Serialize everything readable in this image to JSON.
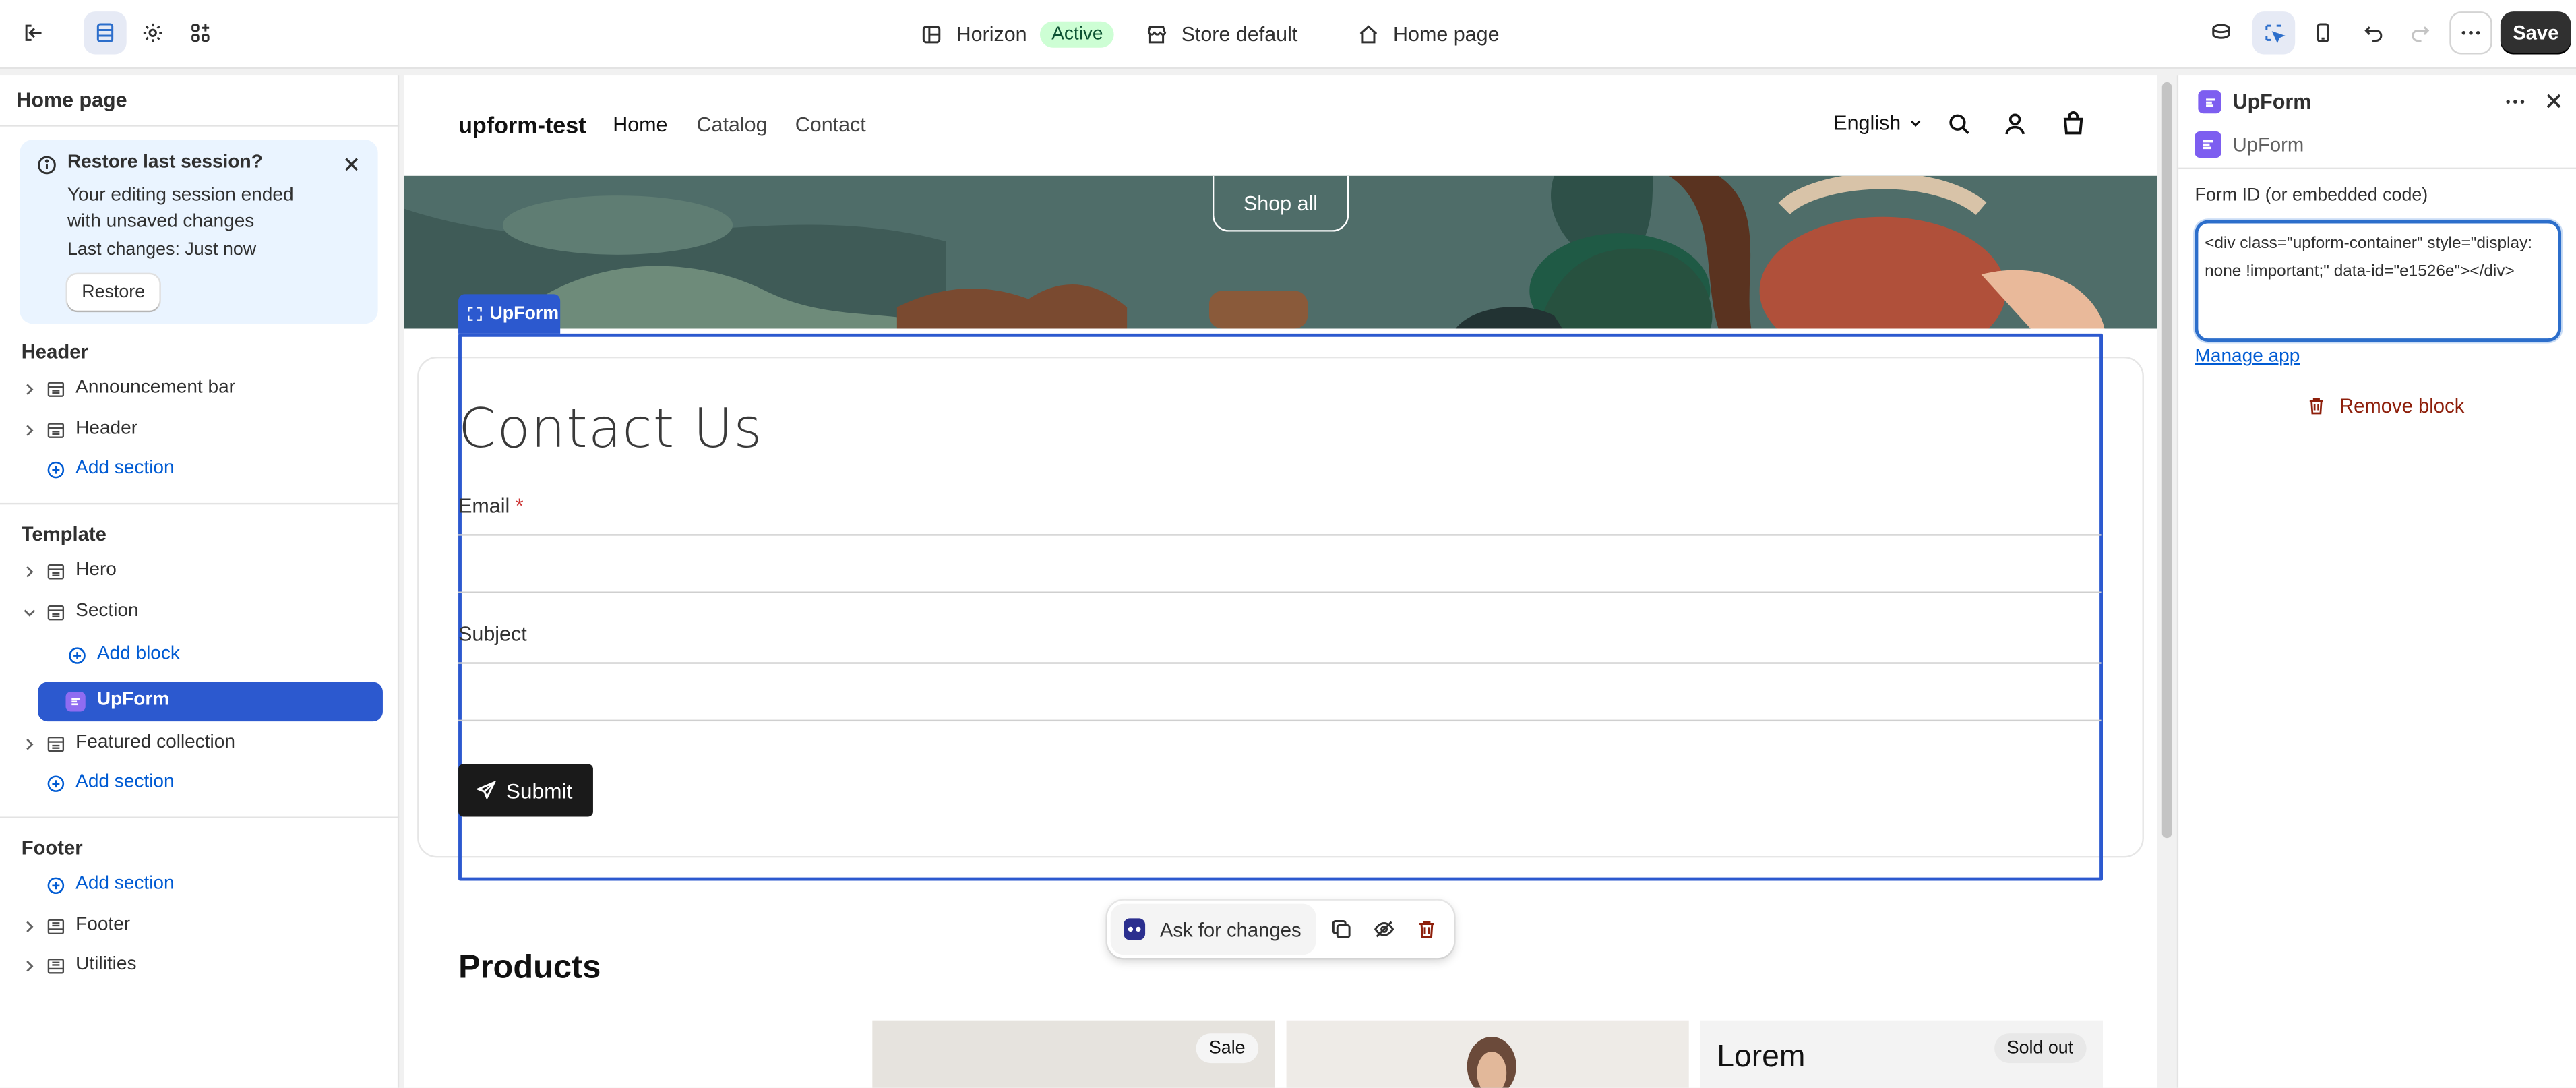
{
  "topbar": {
    "theme_name": "Horizon",
    "theme_status": "Active",
    "store": "Store default",
    "page": "Home page",
    "save_label": "Save"
  },
  "sidebar": {
    "title": "Home page",
    "restore": {
      "title": "Restore last session?",
      "description": "Your editing session ended with unsaved changes",
      "last_changes": "Last changes: Just now",
      "button": "Restore"
    },
    "header_group": "Header",
    "header_items": [
      "Announcement bar",
      "Header"
    ],
    "add_section": "Add section",
    "template_group": "Template",
    "template_items": [
      "Hero",
      "Section"
    ],
    "add_block": "Add block",
    "selected_block": "UpForm",
    "featured": "Featured collection",
    "footer_group": "Footer",
    "footer_items": [
      "Footer",
      "Utilities"
    ]
  },
  "preview": {
    "store_name": "upform-test",
    "nav": [
      "Home",
      "Catalog",
      "Contact"
    ],
    "language": "English",
    "shop_all": "Shop all",
    "block_tag": "UpForm",
    "form_title": "Contact Us",
    "email_label": "Email",
    "required_mark": "*",
    "subject_label": "Subject",
    "submit_label": "Submit",
    "ask_for_changes": "Ask for changes",
    "products_title": "Products",
    "sale_badge": "Sale",
    "sold_out_badge": "Sold out",
    "lorem": "Lorem"
  },
  "panel": {
    "title": "UpForm",
    "subtitle": "UpForm",
    "field_label": "Form ID (or embedded code)",
    "field_value": "<div class=\"upform-container\" style=\"display: none !important;\" data-id=\"e1526e\"></div>",
    "manage_app": "Manage app",
    "remove_block": "Remove block"
  },
  "colors": {
    "accent": "#2c59cf",
    "selection_outline": "#2c59cf",
    "danger": "#8e1f0b",
    "link": "#005bd3"
  }
}
